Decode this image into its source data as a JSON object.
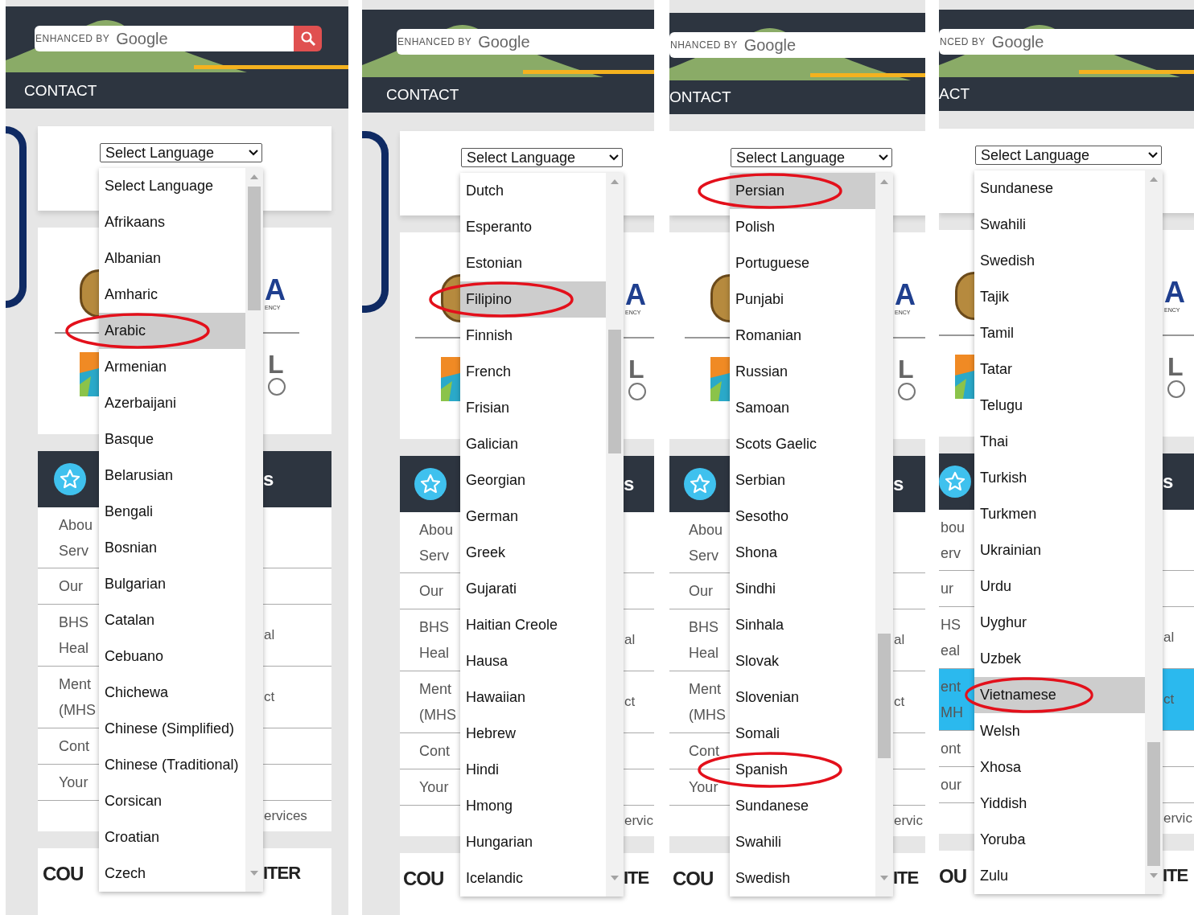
{
  "panels": [
    {
      "search": {
        "prefix": "ENHANCED BY",
        "brand": "Google"
      },
      "search_button": true,
      "nav": "CONTACT",
      "select": "Select Language",
      "logo_letters": {
        "top": "A",
        "tag": "ENCY",
        "bottom": "L"
      },
      "services_title": "s",
      "rows": [
        {
          "lines": [
            "Abou",
            "Serv"
          ],
          "highlighted": false
        },
        {
          "lines": [
            "Our"
          ],
          "highlighted": false
        },
        {
          "lines": [
            "BHS",
            "Heal"
          ],
          "right": "al",
          "highlighted": false
        },
        {
          "lines": [
            "Ment",
            "(MHS"
          ],
          "right": "ct",
          "highlighted": false
        },
        {
          "lines": [
            "Cont"
          ],
          "highlighted": false
        },
        {
          "lines": [
            "Your"
          ],
          "highlighted": false
        },
        {
          "right": "ervices",
          "highlighted": false
        }
      ],
      "footer": {
        "left": "COU",
        "right": "ITER"
      },
      "options": [
        {
          "label": "Select Language",
          "selected": false,
          "circled": false
        },
        {
          "label": "Afrikaans",
          "selected": false,
          "circled": false
        },
        {
          "label": "Albanian",
          "selected": false,
          "circled": false
        },
        {
          "label": "Amharic",
          "selected": false,
          "circled": false
        },
        {
          "label": "Arabic",
          "selected": true,
          "circled": true
        },
        {
          "label": "Armenian",
          "selected": false,
          "circled": false
        },
        {
          "label": "Azerbaijani",
          "selected": false,
          "circled": false
        },
        {
          "label": "Basque",
          "selected": false,
          "circled": false
        },
        {
          "label": "Belarusian",
          "selected": false,
          "circled": false
        },
        {
          "label": "Bengali",
          "selected": false,
          "circled": false
        },
        {
          "label": "Bosnian",
          "selected": false,
          "circled": false
        },
        {
          "label": "Bulgarian",
          "selected": false,
          "circled": false
        },
        {
          "label": "Catalan",
          "selected": false,
          "circled": false
        },
        {
          "label": "Cebuano",
          "selected": false,
          "circled": false
        },
        {
          "label": "Chichewa",
          "selected": false,
          "circled": false
        },
        {
          "label": "Chinese (Simplified)",
          "selected": false,
          "circled": false
        },
        {
          "label": "Chinese (Traditional)",
          "selected": false,
          "circled": false
        },
        {
          "label": "Corsican",
          "selected": false,
          "circled": false
        },
        {
          "label": "Croatian",
          "selected": false,
          "circled": false
        },
        {
          "label": "Czech",
          "selected": false,
          "circled": false
        }
      ]
    },
    {
      "search": {
        "prefix": "ENHANCED BY",
        "brand": "Google"
      },
      "nav": "CONTACT",
      "select": "Select Language",
      "logo_letters": {
        "top": "A",
        "tag": "ENCY",
        "bottom": "L"
      },
      "services_title": "s",
      "rows": [
        {
          "lines": [
            "Abou",
            "Serv"
          ],
          "highlighted": false
        },
        {
          "lines": [
            "Our"
          ],
          "highlighted": false
        },
        {
          "lines": [
            "BHS",
            "Heal"
          ],
          "right": "al",
          "highlighted": false
        },
        {
          "lines": [
            "Ment",
            "(MHS"
          ],
          "right": "ct",
          "highlighted": false
        },
        {
          "lines": [
            "Cont"
          ],
          "highlighted": false
        },
        {
          "lines": [
            "Your"
          ],
          "highlighted": false
        },
        {
          "right": "ervic",
          "highlighted": false
        }
      ],
      "footer": {
        "left": "COU",
        "right": "ITE"
      },
      "options": [
        {
          "label": "Dutch",
          "selected": false,
          "circled": false
        },
        {
          "label": "Esperanto",
          "selected": false,
          "circled": false
        },
        {
          "label": "Estonian",
          "selected": false,
          "circled": false
        },
        {
          "label": "Filipino",
          "selected": true,
          "circled": true
        },
        {
          "label": "Finnish",
          "selected": false,
          "circled": false
        },
        {
          "label": "French",
          "selected": false,
          "circled": false
        },
        {
          "label": "Frisian",
          "selected": false,
          "circled": false
        },
        {
          "label": "Galician",
          "selected": false,
          "circled": false
        },
        {
          "label": "Georgian",
          "selected": false,
          "circled": false
        },
        {
          "label": "German",
          "selected": false,
          "circled": false
        },
        {
          "label": "Greek",
          "selected": false,
          "circled": false
        },
        {
          "label": "Gujarati",
          "selected": false,
          "circled": false
        },
        {
          "label": "Haitian Creole",
          "selected": false,
          "circled": false
        },
        {
          "label": "Hausa",
          "selected": false,
          "circled": false
        },
        {
          "label": "Hawaiian",
          "selected": false,
          "circled": false
        },
        {
          "label": "Hebrew",
          "selected": false,
          "circled": false
        },
        {
          "label": "Hindi",
          "selected": false,
          "circled": false
        },
        {
          "label": "Hmong",
          "selected": false,
          "circled": false
        },
        {
          "label": "Hungarian",
          "selected": false,
          "circled": false
        },
        {
          "label": "Icelandic",
          "selected": false,
          "circled": false
        }
      ]
    },
    {
      "search": {
        "prefix": "NHANCED BY",
        "brand": "Google"
      },
      "nav": "ONTACT",
      "select": "Select Language",
      "logo_letters": {
        "top": "A",
        "tag": "ENCY",
        "bottom": "L"
      },
      "services_title": "s",
      "rows": [
        {
          "lines": [
            "Abou",
            "Serv"
          ],
          "highlighted": false
        },
        {
          "lines": [
            "Our"
          ],
          "highlighted": false
        },
        {
          "lines": [
            "BHS",
            "Heal"
          ],
          "right": "al",
          "highlighted": false
        },
        {
          "lines": [
            "Ment",
            "(MHS"
          ],
          "right": "ct",
          "highlighted": false
        },
        {
          "lines": [
            "Cont"
          ],
          "highlighted": false
        },
        {
          "lines": [
            "Your"
          ],
          "highlighted": false
        },
        {
          "right": "ervic",
          "highlighted": false
        }
      ],
      "footer": {
        "left": "COU",
        "right": "ITE"
      },
      "options": [
        {
          "label": "Persian",
          "selected": true,
          "circled": true
        },
        {
          "label": "Polish",
          "selected": false,
          "circled": false
        },
        {
          "label": "Portuguese",
          "selected": false,
          "circled": false
        },
        {
          "label": "Punjabi",
          "selected": false,
          "circled": false
        },
        {
          "label": "Romanian",
          "selected": false,
          "circled": false
        },
        {
          "label": "Russian",
          "selected": false,
          "circled": false
        },
        {
          "label": "Samoan",
          "selected": false,
          "circled": false
        },
        {
          "label": "Scots Gaelic",
          "selected": false,
          "circled": false
        },
        {
          "label": "Serbian",
          "selected": false,
          "circled": false
        },
        {
          "label": "Sesotho",
          "selected": false,
          "circled": false
        },
        {
          "label": "Shona",
          "selected": false,
          "circled": false
        },
        {
          "label": "Sindhi",
          "selected": false,
          "circled": false
        },
        {
          "label": "Sinhala",
          "selected": false,
          "circled": false
        },
        {
          "label": "Slovak",
          "selected": false,
          "circled": false
        },
        {
          "label": "Slovenian",
          "selected": false,
          "circled": false
        },
        {
          "label": "Somali",
          "selected": false,
          "circled": false
        },
        {
          "label": "Spanish",
          "selected": false,
          "circled": true
        },
        {
          "label": "Sundanese",
          "selected": false,
          "circled": false
        },
        {
          "label": "Swahili",
          "selected": false,
          "circled": false
        },
        {
          "label": "Swedish",
          "selected": false,
          "circled": false
        }
      ]
    },
    {
      "search": {
        "prefix": "NCED BY",
        "brand": "Google"
      },
      "nav": "ACT",
      "select": "Select Language",
      "logo_letters": {
        "top": "A",
        "tag": "ENCY",
        "bottom": "L"
      },
      "services_title": "s",
      "rows": [
        {
          "lines": [
            "bou",
            "erv"
          ],
          "highlighted": false
        },
        {
          "lines": [
            "ur"
          ],
          "highlighted": false
        },
        {
          "lines": [
            "HS",
            "eal"
          ],
          "right": "al",
          "highlighted": false
        },
        {
          "lines": [
            "ent",
            "MH"
          ],
          "right": "ct",
          "highlighted": true
        },
        {
          "lines": [
            "ont"
          ],
          "highlighted": false
        },
        {
          "lines": [
            "our"
          ],
          "highlighted": false
        },
        {
          "right": "ervic",
          "highlighted": false
        }
      ],
      "footer": {
        "left": "OU",
        "right": "ITE"
      },
      "options": [
        {
          "label": "Sundanese",
          "selected": false,
          "circled": false
        },
        {
          "label": "Swahili",
          "selected": false,
          "circled": false
        },
        {
          "label": "Swedish",
          "selected": false,
          "circled": false
        },
        {
          "label": "Tajik",
          "selected": false,
          "circled": false
        },
        {
          "label": "Tamil",
          "selected": false,
          "circled": false
        },
        {
          "label": "Tatar",
          "selected": false,
          "circled": false
        },
        {
          "label": "Telugu",
          "selected": false,
          "circled": false
        },
        {
          "label": "Thai",
          "selected": false,
          "circled": false
        },
        {
          "label": "Turkish",
          "selected": false,
          "circled": false
        },
        {
          "label": "Turkmen",
          "selected": false,
          "circled": false
        },
        {
          "label": "Ukrainian",
          "selected": false,
          "circled": false
        },
        {
          "label": "Urdu",
          "selected": false,
          "circled": false
        },
        {
          "label": "Uyghur",
          "selected": false,
          "circled": false
        },
        {
          "label": "Uzbek",
          "selected": false,
          "circled": false
        },
        {
          "label": "Vietnamese",
          "selected": true,
          "circled": true
        },
        {
          "label": "Welsh",
          "selected": false,
          "circled": false
        },
        {
          "label": "Xhosa",
          "selected": false,
          "circled": false
        },
        {
          "label": "Yiddish",
          "selected": false,
          "circled": false
        },
        {
          "label": "Yoruba",
          "selected": false,
          "circled": false
        },
        {
          "label": "Zulu",
          "selected": false,
          "circled": false
        }
      ]
    }
  ]
}
